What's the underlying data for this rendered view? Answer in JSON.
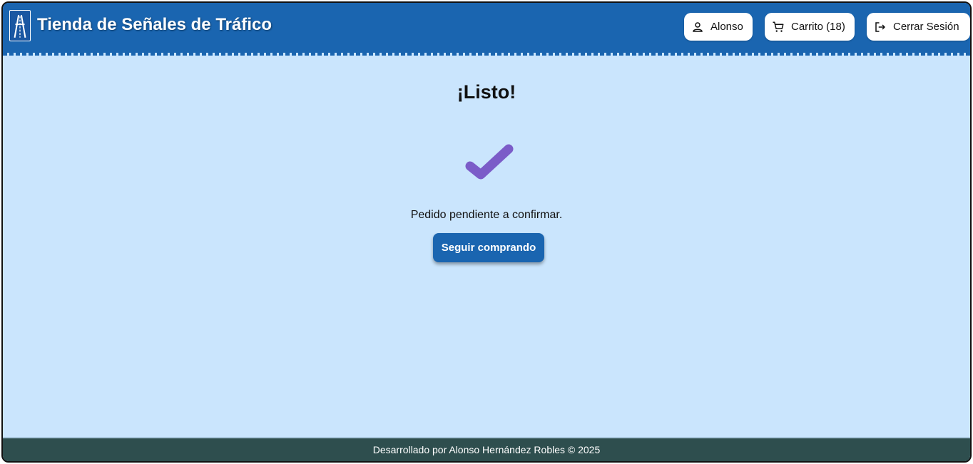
{
  "header": {
    "title": "Tienda de Señales de Tráfico",
    "logo_icon": "highway-sign-icon",
    "user_label": "Alonso",
    "user_icon": "user-icon",
    "cart_label": "Carrito (18)",
    "cart_icon": "cart-icon",
    "logout_label": "Cerrar Sesión",
    "logout_icon": "logout-icon"
  },
  "main": {
    "heading": "¡Listo!",
    "check_icon": "checkmark-icon",
    "status_text": "Pedido pendiente a confirmar.",
    "continue_label": "Seguir comprando"
  },
  "footer": {
    "text": "Desarrollado por Alonso Hernández Robles © 2025"
  },
  "colors": {
    "header_bg": "#1a65b0",
    "page_bg": "#cae5fd",
    "accent_check": "#7b5cc8",
    "button_bg": "#1a65b0",
    "footer_bg": "#2e4e4e"
  }
}
